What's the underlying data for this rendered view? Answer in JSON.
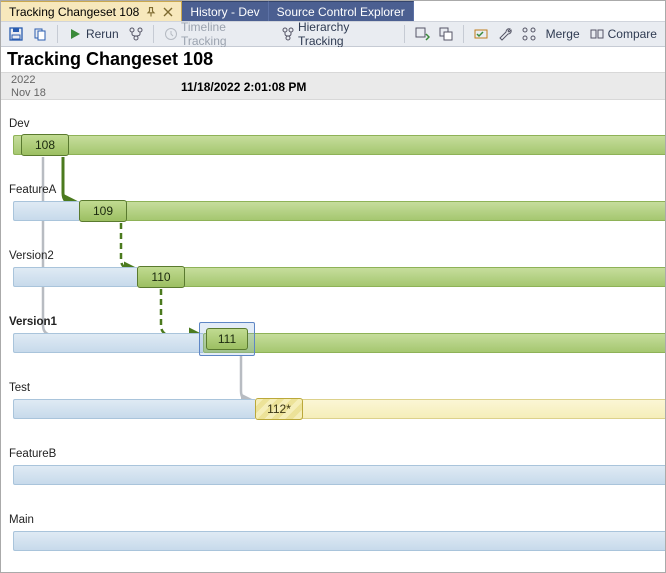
{
  "tabs": {
    "active": {
      "label": "Tracking Changeset 108"
    },
    "inactive1": {
      "label": "History - Dev"
    },
    "inactive2": {
      "label": "Source Control Explorer"
    }
  },
  "toolbar": {
    "rerun": "Rerun",
    "timeline": "Timeline Tracking",
    "hierarchy": "Hierarchy Tracking",
    "merge": "Merge",
    "compare": "Compare"
  },
  "title": "Tracking Changeset 108",
  "header": {
    "year": "2022",
    "day": "Nov 18",
    "datetime": "11/18/2022 2:01:08 PM"
  },
  "branches": {
    "dev": "Dev",
    "featureA": "FeatureA",
    "version2": "Version2",
    "version1": "Version1",
    "test": "Test",
    "featureB": "FeatureB",
    "main": "Main"
  },
  "nodes": {
    "n108": "108",
    "n109": "109",
    "n110": "110",
    "n111": "111",
    "n112": "112*"
  }
}
